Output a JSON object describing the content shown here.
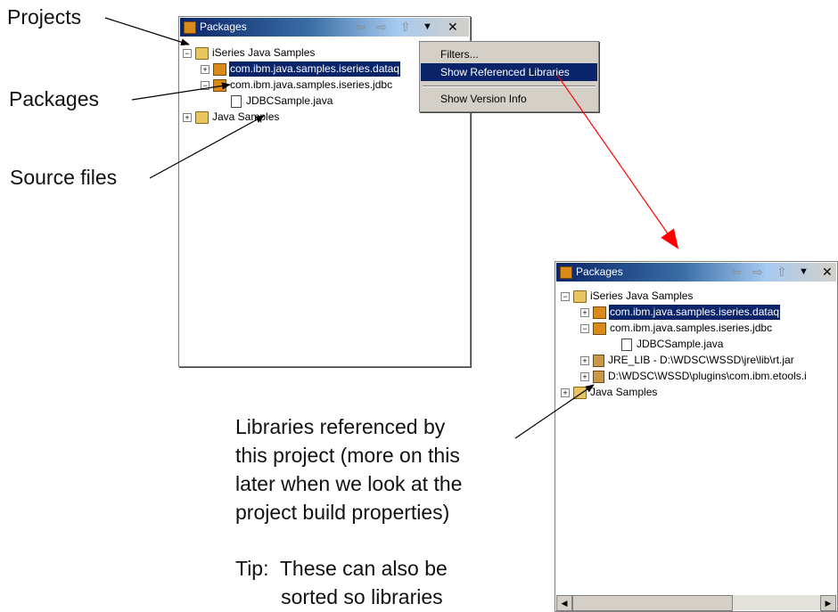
{
  "callouts": {
    "projects": "Projects",
    "packages": "Packages",
    "source_files": "Source files"
  },
  "note_libraries": "Libraries referenced by\nthis project (more on this\nlater when we look at the\nproject build properties)",
  "note_tip": "Tip:  These can also be\n        sorted so libraries",
  "panel_left": {
    "title": "Packages",
    "items": [
      "iSeries Java Samples",
      "com.ibm.java.samples.iseries.dataq",
      "com.ibm.java.samples.iseries.jdbc",
      "JDBCSample.java",
      "Java Samples"
    ]
  },
  "menu": {
    "filters": "Filters...",
    "show_referenced_libraries": "Show Referenced Libraries",
    "show_version_info": "Show Version Info"
  },
  "panel_right": {
    "title": "Packages",
    "items": [
      "iSeries Java Samples",
      "com.ibm.java.samples.iseries.dataq",
      "com.ibm.java.samples.iseries.jdbc",
      "JDBCSample.java",
      "JRE_LIB - D:\\WDSC\\WSSD\\jre\\lib\\rt.jar",
      "D:\\WDSC\\WSSD\\plugins\\com.ibm.etools.i",
      "Java Samples"
    ]
  },
  "toolbar_glyphs": {
    "back": "⇦",
    "forward": "⇨",
    "up": "⇧",
    "menu": "▼",
    "close": "✕"
  },
  "colors": {
    "selection": "#0a246a",
    "arrow_red": "#ff0000"
  }
}
